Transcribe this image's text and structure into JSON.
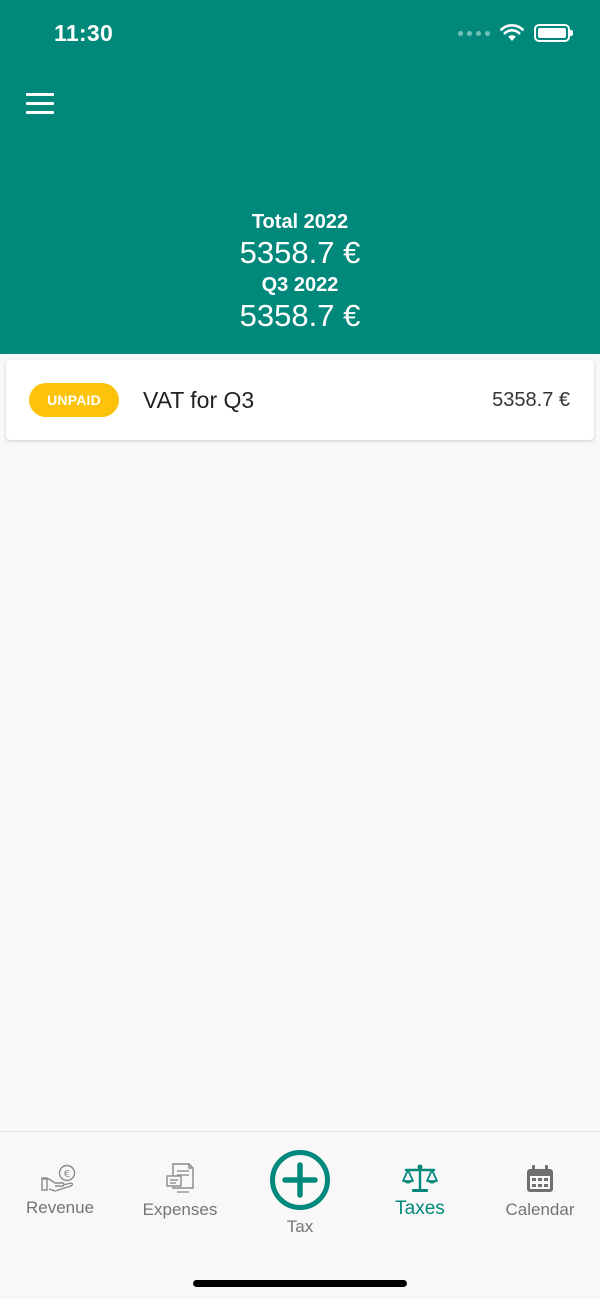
{
  "status_bar": {
    "time": "11:30"
  },
  "header": {
    "total_label": "Total 2022",
    "total_value": "5358.7 €",
    "quarter_label": "Q3 2022",
    "quarter_value": "5358.7 €"
  },
  "taxes": [
    {
      "badge": "UNPAID",
      "title": "VAT for Q3",
      "amount": "5358.7 €"
    }
  ],
  "nav": {
    "revenue": "Revenue",
    "expenses": "Expenses",
    "tax": "Tax",
    "taxes": "Taxes",
    "calendar": "Calendar",
    "active": "Taxes"
  },
  "colors": {
    "primary": "#00897b",
    "unpaid_badge": "#fcc30a",
    "background": "#f8f8f8"
  },
  "icons": [
    "menu-icon",
    "wifi-icon",
    "battery-icon",
    "revenue-hand-euro-icon",
    "expenses-receipt-icon",
    "add-circle-icon",
    "scales-icon",
    "calendar-icon"
  ]
}
